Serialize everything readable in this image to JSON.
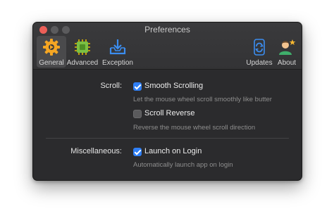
{
  "window": {
    "title": "Preferences"
  },
  "toolbar": {
    "tabs": [
      {
        "label": "General",
        "icon": "gear-icon",
        "active": true
      },
      {
        "label": "Advanced",
        "icon": "chip-icon",
        "active": false
      },
      {
        "label": "Exception",
        "icon": "download-tray-icon",
        "active": false
      },
      {
        "label": "Updates",
        "icon": "refresh-icon",
        "active": false
      },
      {
        "label": "About",
        "icon": "user-star-icon",
        "active": false
      }
    ]
  },
  "scroll": {
    "label": "Scroll:",
    "smooth": {
      "label": "Smooth Scrolling",
      "checked": true,
      "hint": "Let the mouse wheel scroll smoothly like butter"
    },
    "reverse": {
      "label": "Scroll Reverse",
      "checked": false,
      "hint": "Reverse the mouse wheel scroll direction"
    }
  },
  "misc": {
    "label": "Miscellaneous:",
    "launch": {
      "label": "Launch on Login",
      "checked": true,
      "hint": "Automatically launch app on login"
    }
  },
  "colors": {
    "accent": "#2f7ff6",
    "window_bg": "#2b2b2d",
    "close": "#ec5f58",
    "gear": "#f5a623",
    "chip": "#7ac043"
  }
}
